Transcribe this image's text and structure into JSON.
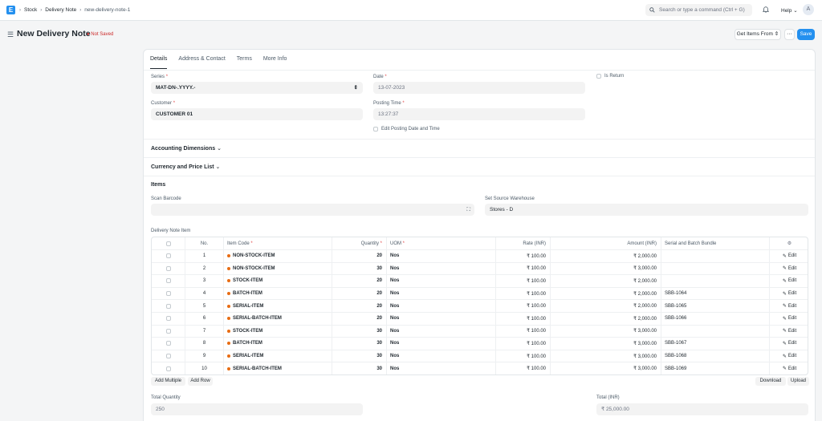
{
  "navbar": {
    "logo": "E",
    "breadcrumbs": [
      "Stock",
      "Delivery Note",
      "new-delivery-note-1"
    ],
    "search_placeholder": "Search or type a command (Ctrl + G)",
    "help_label": "Help",
    "avatar_initial": "A"
  },
  "page": {
    "title": "New Delivery Note",
    "status": "Not Saved",
    "get_items_label": "Get Items From",
    "more_label": "···",
    "save_label": "Save"
  },
  "tabs": [
    "Details",
    "Address & Contact",
    "Terms",
    "More Info"
  ],
  "form": {
    "series_label": "Series",
    "series_value": "MAT-DN-.YYYY.-",
    "customer_label": "Customer",
    "customer_value": "CUSTOMER 01",
    "date_label": "Date",
    "date_value": "13-07-2023",
    "posting_time_label": "Posting Time",
    "posting_time_value": "13:27:37",
    "edit_posting_label": "Edit Posting Date and Time",
    "is_return_label": "Is Return",
    "required_mark": "*"
  },
  "sections": {
    "accounting": "Accounting Dimensions",
    "currency": "Currency and Price List",
    "items": "Items"
  },
  "items_section": {
    "scan_barcode_label": "Scan Barcode",
    "set_source_label": "Set Source Warehouse",
    "set_source_value": "Stores - D",
    "table_label": "Delivery Note Item"
  },
  "table": {
    "headers": {
      "no": "No.",
      "item_code": "Item Code",
      "quantity": "Quantity",
      "uom": "UOM",
      "rate": "Rate (INR)",
      "amount": "Amount (INR)",
      "sbb": "Serial and Batch Bundle"
    },
    "edit_label": "Edit",
    "rows": [
      {
        "no": "1",
        "item": "NON-STOCK-ITEM",
        "qty": "20",
        "uom": "Nos",
        "rate": "₹ 100.00",
        "amount": "₹ 2,000.00",
        "sbb": ""
      },
      {
        "no": "2",
        "item": "NON-STOCK-ITEM",
        "qty": "30",
        "uom": "Nos",
        "rate": "₹ 100.00",
        "amount": "₹ 3,000.00",
        "sbb": ""
      },
      {
        "no": "3",
        "item": "STOCK-ITEM",
        "qty": "20",
        "uom": "Nos",
        "rate": "₹ 100.00",
        "amount": "₹ 2,000.00",
        "sbb": ""
      },
      {
        "no": "4",
        "item": "BATCH-ITEM",
        "qty": "20",
        "uom": "Nos",
        "rate": "₹ 100.00",
        "amount": "₹ 2,000.00",
        "sbb": "SBB-1064"
      },
      {
        "no": "5",
        "item": "SERIAL-ITEM",
        "qty": "20",
        "uom": "Nos",
        "rate": "₹ 100.00",
        "amount": "₹ 2,000.00",
        "sbb": "SBB-1065"
      },
      {
        "no": "6",
        "item": "SERIAL-BATCH-ITEM",
        "qty": "20",
        "uom": "Nos",
        "rate": "₹ 100.00",
        "amount": "₹ 2,000.00",
        "sbb": "SBB-1066"
      },
      {
        "no": "7",
        "item": "STOCK-ITEM",
        "qty": "30",
        "uom": "Nos",
        "rate": "₹ 100.00",
        "amount": "₹ 3,000.00",
        "sbb": ""
      },
      {
        "no": "8",
        "item": "BATCH-ITEM",
        "qty": "30",
        "uom": "Nos",
        "rate": "₹ 100.00",
        "amount": "₹ 3,000.00",
        "sbb": "SBB-1067"
      },
      {
        "no": "9",
        "item": "SERIAL-ITEM",
        "qty": "30",
        "uom": "Nos",
        "rate": "₹ 100.00",
        "amount": "₹ 3,000.00",
        "sbb": "SBB-1068"
      },
      {
        "no": "10",
        "item": "SERIAL-BATCH-ITEM",
        "qty": "30",
        "uom": "Nos",
        "rate": "₹ 100.00",
        "amount": "₹ 3,000.00",
        "sbb": "SBB-1069"
      }
    ]
  },
  "grid_actions": {
    "add_multiple": "Add Multiple",
    "add_row": "Add Row",
    "download": "Download",
    "upload": "Upload"
  },
  "totals": {
    "total_quantity_label": "Total Quantity",
    "total_quantity_value": "250",
    "total_inr_label": "Total (INR)",
    "total_inr_value": "₹ 25,000.00"
  },
  "colors": {
    "primary": "#2490ef",
    "not_saved": "#cb2929",
    "indicator": "#e86c13"
  }
}
